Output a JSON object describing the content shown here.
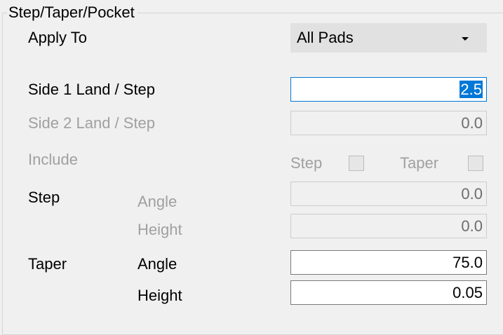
{
  "group": {
    "title": "Step/Taper/Pocket"
  },
  "apply_to": {
    "label": "Apply To",
    "value": "All Pads"
  },
  "side1": {
    "label": "Side 1 Land / Step",
    "value": "2.5"
  },
  "side2": {
    "label": "Side 2 Land / Step",
    "value": "0.0"
  },
  "include": {
    "label": "Include",
    "step_label": "Step",
    "step_checked": false,
    "taper_label": "Taper",
    "taper_checked": false
  },
  "step": {
    "label": "Step",
    "angle_label": "Angle",
    "angle_value": "0.0",
    "height_label": "Height",
    "height_value": "0.0"
  },
  "taper": {
    "label": "Taper",
    "angle_label": "Angle",
    "angle_value": "75.0",
    "height_label": "Height",
    "height_value": "0.05"
  },
  "colors": {
    "background": "#f0f0f0",
    "focus_border": "#0078d7",
    "selection": "#0078d7",
    "disabled_text": "#a0a0a0"
  }
}
